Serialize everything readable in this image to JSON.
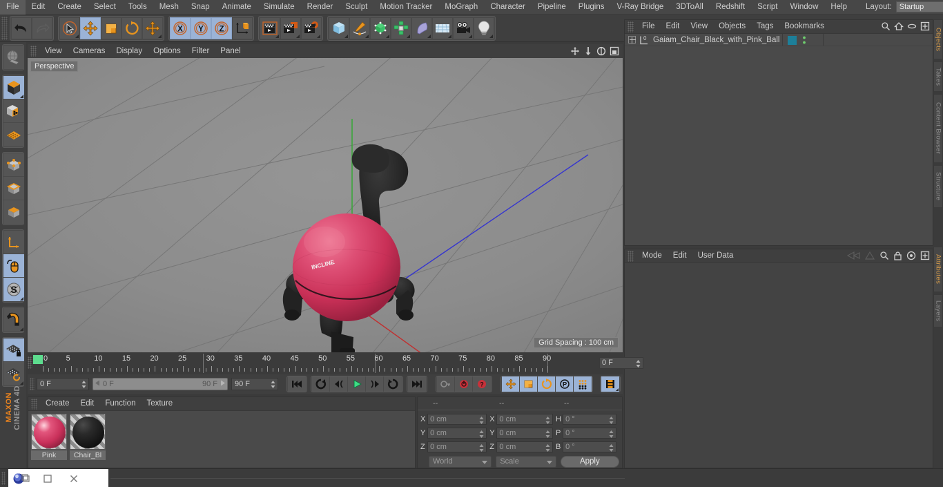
{
  "app": {
    "name": "CINEMA 4D",
    "brand": "MAXON"
  },
  "menubar": {
    "items": [
      "File",
      "Edit",
      "Create",
      "Select",
      "Tools",
      "Mesh",
      "Snap",
      "Animate",
      "Simulate",
      "Render",
      "Sculpt",
      "Motion Tracker",
      "MoGraph",
      "Character",
      "Pipeline",
      "Plugins",
      "V-Ray Bridge",
      "3DToAll",
      "Redshift",
      "Script",
      "Window",
      "Help"
    ],
    "layout_label": "Layout:",
    "layout_value": "Startup",
    "search_icon": "search-icon"
  },
  "toolbar": {
    "groups": [
      {
        "name": "history",
        "buttons": [
          {
            "id": "undo",
            "icon": "undo-arrow-icon",
            "selected": false,
            "corner": false
          },
          {
            "id": "redo",
            "icon": "redo-arrow-icon",
            "selected": false,
            "corner": false
          }
        ]
      },
      {
        "name": "transform-tools",
        "buttons": [
          {
            "id": "live-selection",
            "icon": "cursor-select-icon",
            "selected": false,
            "corner": true
          },
          {
            "id": "move",
            "icon": "move-arrows-icon",
            "selected": true,
            "corner": false
          },
          {
            "id": "scale",
            "icon": "scale-box-icon",
            "selected": false,
            "corner": false
          },
          {
            "id": "rotate",
            "icon": "rotate-circle-icon",
            "selected": false,
            "corner": false
          },
          {
            "id": "move-alt",
            "icon": "move-arrows-icon",
            "selected": false,
            "corner": true
          }
        ]
      },
      {
        "name": "axis-locks",
        "buttons": [
          {
            "id": "lock-x",
            "icon": "axis-x-icon",
            "label": "X",
            "selected": true,
            "corner": false
          },
          {
            "id": "lock-y",
            "icon": "axis-y-icon",
            "label": "Y",
            "selected": true,
            "corner": false
          },
          {
            "id": "lock-z",
            "icon": "axis-z-icon",
            "label": "Z",
            "selected": true,
            "corner": false
          },
          {
            "id": "world-object-axis",
            "icon": "world-axis-cube-icon",
            "selected": false,
            "corner": false
          }
        ]
      },
      {
        "name": "render",
        "buttons": [
          {
            "id": "render-view",
            "icon": "render-clapper-icon",
            "selected": false,
            "corner": true
          },
          {
            "id": "render-region",
            "icon": "render-region-icon",
            "selected": false,
            "corner": true
          },
          {
            "id": "render-settings",
            "icon": "render-settings-icon",
            "selected": false,
            "corner": true
          }
        ]
      },
      {
        "name": "create",
        "buttons": [
          {
            "id": "add-cube",
            "icon": "cube-primitive-icon",
            "selected": false,
            "corner": true
          },
          {
            "id": "add-spline",
            "icon": "pen-spline-icon",
            "selected": false,
            "corner": true
          },
          {
            "id": "add-generator",
            "icon": "generator-cube-icon",
            "selected": false,
            "corner": true
          },
          {
            "id": "add-mograph",
            "icon": "mograph-cluster-icon",
            "selected": false,
            "corner": true
          },
          {
            "id": "add-deformer",
            "icon": "bend-deformer-icon",
            "selected": false,
            "corner": true
          },
          {
            "id": "add-scene",
            "icon": "floor-grid-icon",
            "selected": false,
            "corner": true
          },
          {
            "id": "add-camera",
            "icon": "camera-icon",
            "selected": false,
            "corner": true
          },
          {
            "id": "add-light",
            "icon": "light-bulb-icon",
            "selected": false,
            "corner": true
          }
        ]
      }
    ]
  },
  "leftbar": {
    "groups": [
      {
        "buttons": [
          {
            "id": "undo-view",
            "icon": "globe-world-icon",
            "selected": false,
            "corner": false
          }
        ]
      },
      {
        "buttons": [
          {
            "id": "editable-object",
            "icon": "cube-orange-icon",
            "selected": true,
            "corner": true
          },
          {
            "id": "model-mode",
            "icon": "cube-checker-icon",
            "selected": false,
            "corner": false
          },
          {
            "id": "texture-mode",
            "icon": "texture-grid-icon",
            "selected": false,
            "corner": false
          }
        ]
      },
      {
        "buttons": [
          {
            "id": "points-mode",
            "icon": "points-cube-icon",
            "selected": false,
            "corner": false
          },
          {
            "id": "edges-mode",
            "icon": "edges-cube-icon",
            "selected": false,
            "corner": false
          },
          {
            "id": "polygons-mode",
            "icon": "polygons-cube-icon",
            "selected": false,
            "corner": false
          }
        ]
      },
      {
        "buttons": [
          {
            "id": "object-axis",
            "icon": "axis-corner-icon",
            "selected": false,
            "corner": false
          },
          {
            "id": "enable-snap-tool",
            "icon": "mouse-icon",
            "selected": true,
            "corner": false
          },
          {
            "id": "soft-selection",
            "icon": "s-disc-icon",
            "selected": true,
            "corner": true
          }
        ]
      },
      {
        "buttons": [
          {
            "id": "magnet",
            "icon": "magnet-icon",
            "selected": false,
            "corner": true
          }
        ]
      },
      {
        "buttons": [
          {
            "id": "workplane-lock",
            "icon": "workplane-lock-icon",
            "selected": true,
            "corner": false
          },
          {
            "id": "workplane-rotate",
            "icon": "workplane-rotate-icon",
            "selected": false,
            "corner": true
          }
        ]
      }
    ]
  },
  "viewport": {
    "menu": [
      "View",
      "Cameras",
      "Display",
      "Options",
      "Filter",
      "Panel"
    ],
    "corner_icons": [
      "move-view-icon",
      "zoom-view-icon",
      "rotate-view-icon",
      "maximize-view-icon"
    ],
    "label": "Perspective",
    "grid_spacing": "Grid Spacing : 100 cm",
    "axis_gizmo": {
      "x": "X",
      "y": "Y",
      "z": "Z"
    },
    "scene_object": "Gaiam Chair Black with Pink Ball",
    "ball_text": "INCLINE"
  },
  "object_manager": {
    "menu": [
      "File",
      "Edit",
      "View",
      "Objects",
      "Tags",
      "Bookmarks"
    ],
    "corner_icons": [
      "search-icon",
      "home-icon",
      "ellipse-icon",
      "plus-box-icon"
    ],
    "rows": [
      {
        "name": "Gaiam_Chair_Black_with_Pink_Ball",
        "icon": "null-object-icon",
        "expandable": true,
        "tag_color": "#1d7f99"
      }
    ]
  },
  "attributes": {
    "menu": [
      "Mode",
      "Edit",
      "User Data"
    ],
    "corner_icons": [
      "nav-back-icon",
      "nav-forward-icon",
      "search-icon",
      "lock-icon",
      "target-icon",
      "plus-box-icon"
    ]
  },
  "vtabs": [
    {
      "label": "Objects",
      "active": true
    },
    {
      "label": "Takes",
      "active": false
    },
    {
      "label": "Content Browser",
      "active": false
    },
    {
      "label": "Structure",
      "active": false
    },
    {
      "label": "Attributes",
      "active": true
    },
    {
      "label": "Layers",
      "active": false
    }
  ],
  "timeline": {
    "ticks": [
      0,
      5,
      10,
      15,
      20,
      25,
      30,
      35,
      40,
      45,
      50,
      55,
      60,
      65,
      70,
      75,
      80,
      85,
      90
    ],
    "current_frame_field": "0 F",
    "start_frame": "0 F",
    "range_start": "0 F",
    "range_end": "90 F",
    "end_frame": "90 F"
  },
  "playback": {
    "buttons": [
      {
        "id": "goto-start",
        "icon": "skip-start-icon",
        "selected": false
      },
      {
        "id": "play-reverse-keyframe",
        "icon": "loop-back-icon",
        "selected": false
      },
      {
        "id": "step-back",
        "icon": "step-back-icon",
        "selected": false
      },
      {
        "id": "play",
        "icon": "play-icon",
        "selected": false
      },
      {
        "id": "step-forward",
        "icon": "step-forward-icon",
        "selected": false
      },
      {
        "id": "next-keyframe",
        "icon": "loop-forward-icon",
        "selected": false
      },
      {
        "id": "goto-end",
        "icon": "skip-end-icon",
        "selected": false
      },
      {
        "id": "autokey-toggle",
        "icon": "key-icon",
        "selected": false
      },
      {
        "id": "record-active-objects",
        "icon": "record-ring-icon",
        "selected": false
      },
      {
        "id": "record-help",
        "icon": "record-question-icon",
        "selected": false
      },
      {
        "id": "key-position",
        "icon": "key-position-icon",
        "selected": true
      },
      {
        "id": "key-scale",
        "icon": "key-scale-icon",
        "selected": true
      },
      {
        "id": "key-rotation",
        "icon": "key-rotation-icon",
        "selected": true
      },
      {
        "id": "key-param",
        "icon": "key-param-icon",
        "selected": true
      },
      {
        "id": "key-pla",
        "icon": "key-pla-icon",
        "selected": true
      },
      {
        "id": "timeline-toggle",
        "icon": "film-strip-icon",
        "selected": true
      }
    ]
  },
  "material_manager": {
    "menu": [
      "Create",
      "Edit",
      "Function",
      "Texture"
    ],
    "materials": [
      {
        "name": "Pink",
        "color": "#c9305a",
        "highlight": "#ffdde6"
      },
      {
        "name": "Chair_Bl",
        "color": "#1c1c1c",
        "highlight": "#555555"
      }
    ]
  },
  "coordinates": {
    "headers": [
      "--",
      "--",
      "--"
    ],
    "rows": [
      {
        "pos_label": "X",
        "pos_value": "0 cm",
        "size_label": "X",
        "size_value": "0 cm",
        "rot_label": "H",
        "rot_value": "0 °"
      },
      {
        "pos_label": "Y",
        "pos_value": "0 cm",
        "size_label": "Y",
        "size_value": "0 cm",
        "rot_label": "P",
        "rot_value": "0 °"
      },
      {
        "pos_label": "Z",
        "pos_value": "0 cm",
        "size_label": "Z",
        "size_value": "0 cm",
        "rot_label": "B",
        "rot_value": "0 °"
      }
    ],
    "space_dropdown": "World",
    "mode_dropdown": "Scale",
    "apply_label": "Apply"
  },
  "taskbar": {
    "app_icon": "c4d-app-icon",
    "restore_icon": "restore-window-icon",
    "maximize_icon": "maximize-window-icon",
    "close_icon": "close-window-icon"
  },
  "colors": {
    "accent_orange": "#e8821e",
    "selection_blue": "#9bb3d6",
    "ball_pink": "#cf3a62",
    "chair_black": "#262626",
    "green_play": "#3ddc84",
    "record_red": "#c8313a"
  }
}
